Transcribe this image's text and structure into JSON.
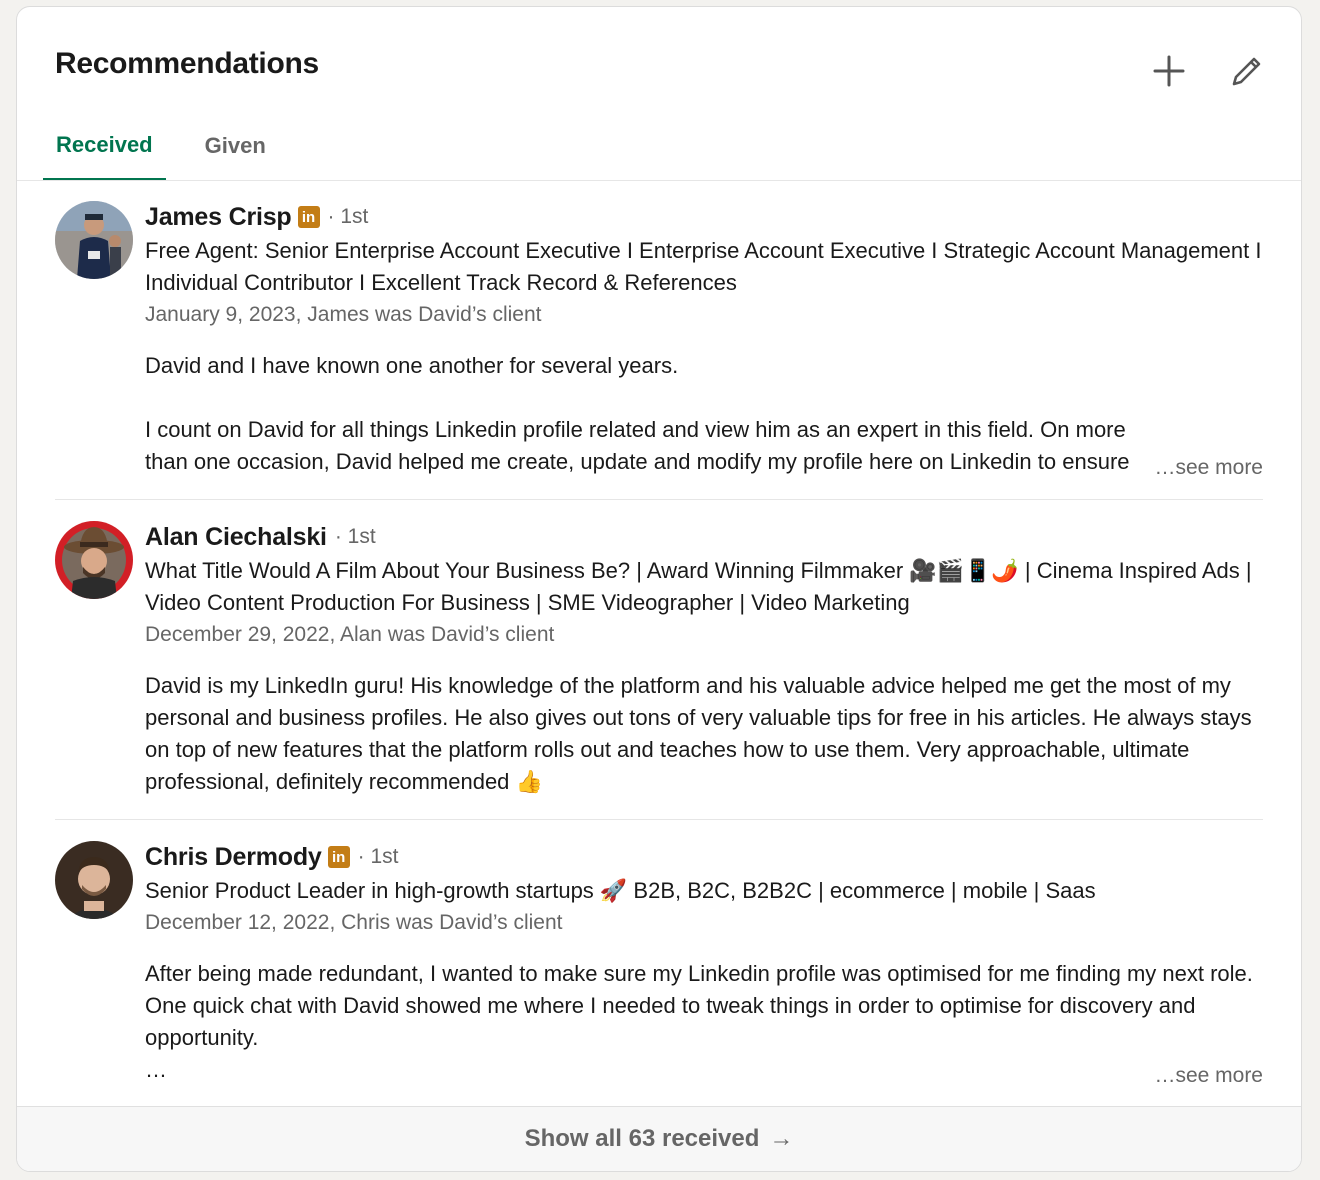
{
  "section": {
    "title": "Recommendations",
    "add_icon": "plus-icon",
    "edit_icon": "pencil-icon"
  },
  "tabs": [
    {
      "label": "Received",
      "active": true
    },
    {
      "label": "Given",
      "active": false
    }
  ],
  "recommendations": [
    {
      "name": "James Crisp",
      "has_linkedin_badge": true,
      "badge_text": "in",
      "degree": "· 1st",
      "headline": "Free Agent: Senior Enterprise Account Executive I Enterprise Account Executive I Strategic Account Management I Individual Contributor I Excellent Track Record & References",
      "meta": "January 9, 2023, James was David’s client",
      "text": [
        "David and I have known one another for several years.",
        "",
        "I count on David for all things Linkedin profile related and view him as an expert in this field. On more than one occasion, David helped me create, update and modify my profile here on Linkedin to ensure"
      ],
      "see_more": "…see more"
    },
    {
      "name": "Alan Ciechalski",
      "has_linkedin_badge": false,
      "degree": "· 1st",
      "headline": "What Title Would A Film About Your Business Be? | Award Winning Filmmaker 🎥🎬📱🌶️ | Cinema Inspired Ads | Video Content Production For Business | SME Videographer | Video Marketing",
      "meta": "December 29, 2022, Alan was David’s client",
      "text": [
        "David is my LinkedIn guru! His knowledge of the platform and his valuable advice helped me get the most of my personal and business profiles. He also gives out tons of very valuable tips for free in his articles. He always stays on top of new features that the platform rolls out and teaches how to use them. Very approachable, ultimate professional, definitely recommended 👍"
      ]
    },
    {
      "name": "Chris Dermody",
      "has_linkedin_badge": true,
      "badge_text": "in",
      "degree": "· 1st",
      "headline": "Senior Product Leader in high-growth startups 🚀 B2B, B2C, B2B2C | ecommerce | mobile | Saas",
      "meta": "December 12, 2022, Chris was David’s client",
      "text": [
        "After being made redundant, I wanted to make sure my Linkedin profile was optimised for me finding my next role. One quick chat with David showed me where I needed to tweak things in order to optimise for discovery and opportunity.",
        "…"
      ],
      "see_more": "…see more"
    }
  ],
  "footer": {
    "label": "Show all 63 received",
    "arrow": "→"
  },
  "colors": {
    "accent": "#01754f",
    "badge": "#c37d16",
    "muted": "#666666"
  }
}
